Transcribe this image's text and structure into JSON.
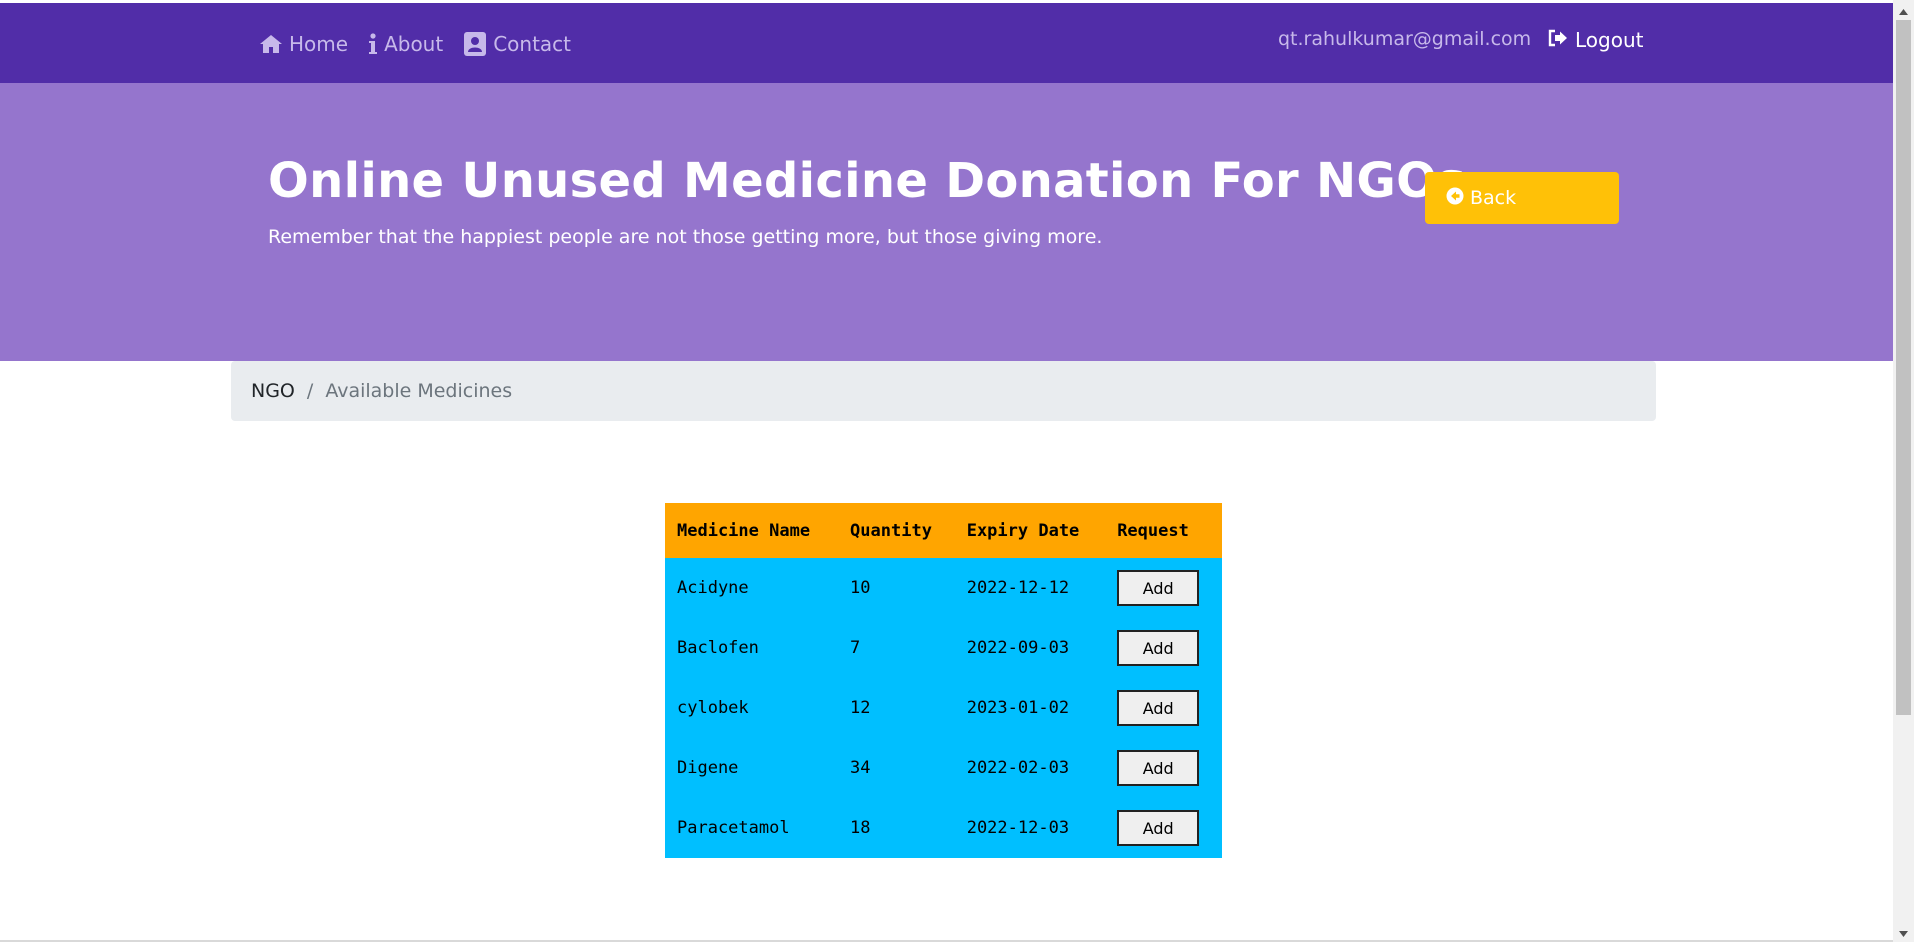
{
  "navbar": {
    "links": [
      {
        "label": "Home",
        "icon": "home-icon"
      },
      {
        "label": "About",
        "icon": "info-icon"
      },
      {
        "label": "Contact",
        "icon": "contact-icon"
      }
    ],
    "email": "qt.rahulkumar@gmail.com",
    "logout_label": "Logout",
    "bg_color": "#512da8"
  },
  "header": {
    "title": "Online Unused Medicine Donation For NGOs",
    "subtitle": "Remember that the happiest people are not those getting more, but those giving more.",
    "back_label": "Back",
    "bg_color": "#9575cd",
    "back_color": "#ffc107"
  },
  "breadcrumb": {
    "items": [
      "NGO",
      "Available Medicines"
    ],
    "separator": "/"
  },
  "table": {
    "headers": [
      "Medicine Name",
      "Quantity",
      "Expiry Date",
      "Request"
    ],
    "rows": [
      {
        "name": "Acidyne",
        "quantity": "10",
        "expiry": "2022-12-12",
        "action": "Add"
      },
      {
        "name": "Baclofen",
        "quantity": "7",
        "expiry": "2022-09-03",
        "action": "Add"
      },
      {
        "name": "cylobek",
        "quantity": "12",
        "expiry": "2023-01-02",
        "action": "Add"
      },
      {
        "name": "Digene",
        "quantity": "34",
        "expiry": "2022-02-03",
        "action": "Add"
      },
      {
        "name": "Paracetamol",
        "quantity": "18",
        "expiry": "2022-12-03",
        "action": "Add"
      }
    ],
    "header_color": "#ffa500",
    "row_color": "#00bfff"
  }
}
